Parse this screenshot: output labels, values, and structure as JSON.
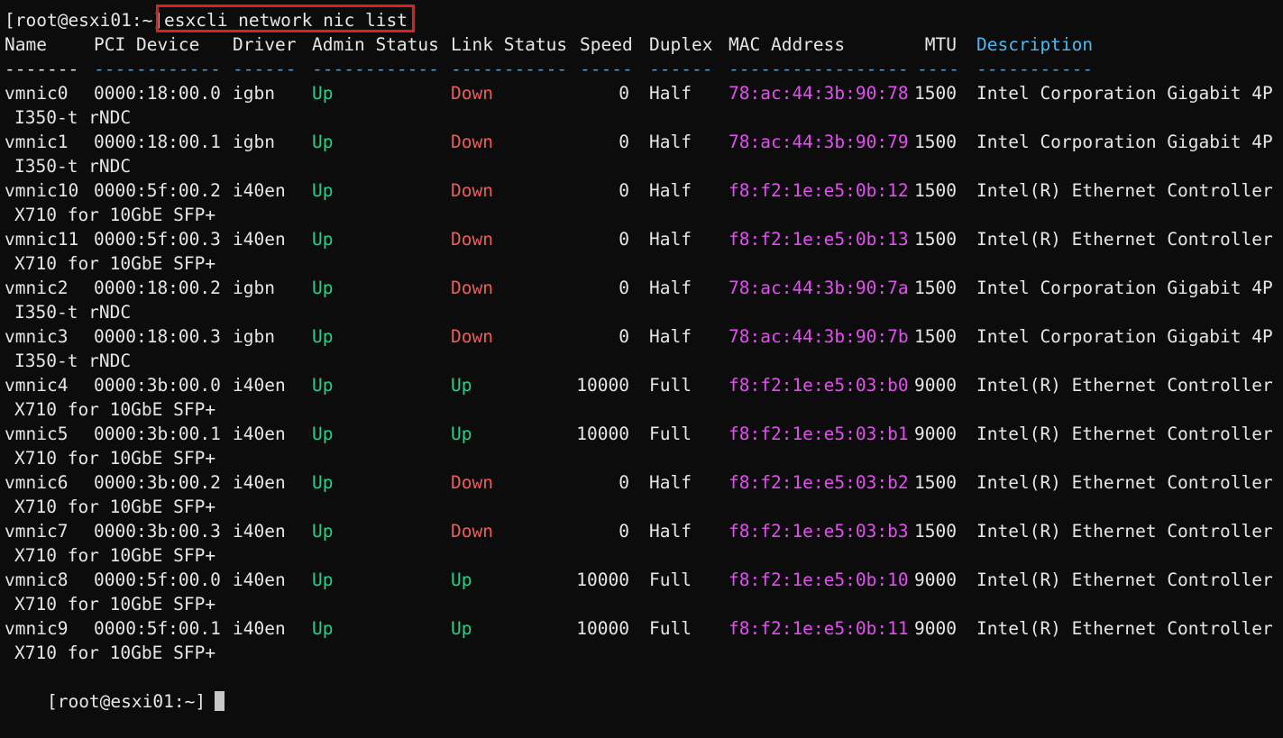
{
  "prompt": "[root@esxi01:~]",
  "command": "esxcli network nic list",
  "headers": {
    "name": "Name",
    "pci": "PCI Device",
    "driver": "Driver",
    "admin": "Admin Status",
    "link": "Link Status",
    "speed": "Speed",
    "duplex": "Duplex",
    "mac": "MAC Address",
    "mtu": "MTU",
    "desc": "Description"
  },
  "dashes": {
    "name": "-------",
    "pci": "------------",
    "driver": "------",
    "admin": "------------",
    "link": "-----------",
    "speed": "-----",
    "duplex": "------",
    "mac": "-----------------",
    "mtu": "----",
    "desc": "-----------"
  },
  "rows": [
    {
      "name": "vmnic0",
      "pci": "0000:18:00.0",
      "driver": "igbn",
      "admin": "Up",
      "link": "Down",
      "speed": "0",
      "duplex": "Half",
      "mac": "78:ac:44:3b:90:78",
      "mtu": "1500",
      "desc": "Intel Corporation Gigabit 4P",
      "desc2": "I350-t rNDC"
    },
    {
      "name": "vmnic1",
      "pci": "0000:18:00.1",
      "driver": "igbn",
      "admin": "Up",
      "link": "Down",
      "speed": "0",
      "duplex": "Half",
      "mac": "78:ac:44:3b:90:79",
      "mtu": "1500",
      "desc": "Intel Corporation Gigabit 4P",
      "desc2": "I350-t rNDC"
    },
    {
      "name": "vmnic10",
      "pci": "0000:5f:00.2",
      "driver": "i40en",
      "admin": "Up",
      "link": "Down",
      "speed": "0",
      "duplex": "Half",
      "mac": "f8:f2:1e:e5:0b:12",
      "mtu": "1500",
      "desc": "Intel(R) Ethernet Controller",
      "desc2": "X710 for 10GbE SFP+"
    },
    {
      "name": "vmnic11",
      "pci": "0000:5f:00.3",
      "driver": "i40en",
      "admin": "Up",
      "link": "Down",
      "speed": "0",
      "duplex": "Half",
      "mac": "f8:f2:1e:e5:0b:13",
      "mtu": "1500",
      "desc": "Intel(R) Ethernet Controller",
      "desc2": "X710 for 10GbE SFP+"
    },
    {
      "name": "vmnic2",
      "pci": "0000:18:00.2",
      "driver": "igbn",
      "admin": "Up",
      "link": "Down",
      "speed": "0",
      "duplex": "Half",
      "mac": "78:ac:44:3b:90:7a",
      "mtu": "1500",
      "desc": "Intel Corporation Gigabit 4P",
      "desc2": "I350-t rNDC"
    },
    {
      "name": "vmnic3",
      "pci": "0000:18:00.3",
      "driver": "igbn",
      "admin": "Up",
      "link": "Down",
      "speed": "0",
      "duplex": "Half",
      "mac": "78:ac:44:3b:90:7b",
      "mtu": "1500",
      "desc": "Intel Corporation Gigabit 4P",
      "desc2": "I350-t rNDC"
    },
    {
      "name": "vmnic4",
      "pci": "0000:3b:00.0",
      "driver": "i40en",
      "admin": "Up",
      "link": "Up",
      "speed": "10000",
      "duplex": "Full",
      "mac": "f8:f2:1e:e5:03:b0",
      "mtu": "9000",
      "desc": "Intel(R) Ethernet Controller",
      "desc2": "X710 for 10GbE SFP+"
    },
    {
      "name": "vmnic5",
      "pci": "0000:3b:00.1",
      "driver": "i40en",
      "admin": "Up",
      "link": "Up",
      "speed": "10000",
      "duplex": "Full",
      "mac": "f8:f2:1e:e5:03:b1",
      "mtu": "9000",
      "desc": "Intel(R) Ethernet Controller",
      "desc2": "X710 for 10GbE SFP+"
    },
    {
      "name": "vmnic6",
      "pci": "0000:3b:00.2",
      "driver": "i40en",
      "admin": "Up",
      "link": "Down",
      "speed": "0",
      "duplex": "Half",
      "mac": "f8:f2:1e:e5:03:b2",
      "mtu": "1500",
      "desc": "Intel(R) Ethernet Controller",
      "desc2": "X710 for 10GbE SFP+"
    },
    {
      "name": "vmnic7",
      "pci": "0000:3b:00.3",
      "driver": "i40en",
      "admin": "Up",
      "link": "Down",
      "speed": "0",
      "duplex": "Half",
      "mac": "f8:f2:1e:e5:03:b3",
      "mtu": "1500",
      "desc": "Intel(R) Ethernet Controller",
      "desc2": "X710 for 10GbE SFP+"
    },
    {
      "name": "vmnic8",
      "pci": "0000:5f:00.0",
      "driver": "i40en",
      "admin": "Up",
      "link": "Up",
      "speed": "10000",
      "duplex": "Full",
      "mac": "f8:f2:1e:e5:0b:10",
      "mtu": "9000",
      "desc": "Intel(R) Ethernet Controller",
      "desc2": "X710 for 10GbE SFP+"
    },
    {
      "name": "vmnic9",
      "pci": "0000:5f:00.1",
      "driver": "i40en",
      "admin": "Up",
      "link": "Up",
      "speed": "10000",
      "duplex": "Full",
      "mac": "f8:f2:1e:e5:0b:11",
      "mtu": "9000",
      "desc": "Intel(R) Ethernet Controller",
      "desc2": "X710 for 10GbE SFP+"
    }
  ],
  "colors": {
    "background": "#0c0c0c",
    "text": "#e6e6e6",
    "up": "#23d18b",
    "down": "#e85f5f",
    "mac": "#e34ff0",
    "description_header": "#4db8f0",
    "highlight_box": "#e01e1e"
  },
  "icons": {
    "cursor": "block-cursor"
  }
}
